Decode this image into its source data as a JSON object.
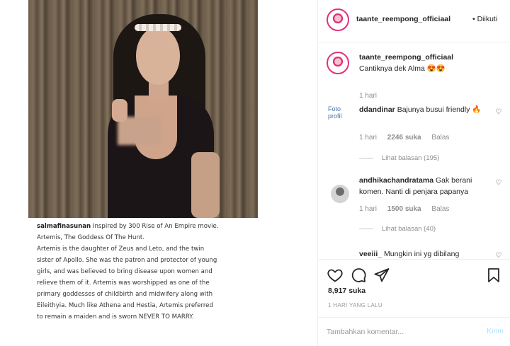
{
  "post": {
    "caption": {
      "username": "salmafinasunan",
      "first_line": "Inspired by 300 Rise of An Empire movie.",
      "lines": [
        "Artemis, The Goddess Of The Hunt.",
        "Artemis is the daughter of Zeus and Leto, and the twin sister of Apollo. She was the patron and protector of young girls, and was believed to bring disease upon women and relieve them of it. Artemis was worshipped as one of the primary goddesses of childbirth and midwifery along with Eileithyia. Much like Athena and Hestia, Artemis preferred to remain a maiden and is sworn NEVER TO MARRY."
      ]
    }
  },
  "header": {
    "username": "taante_reempong_officiaal",
    "follow_status": "• Diikuti"
  },
  "comments": [
    {
      "username": "taante_reempong_officiaal",
      "text": "Cantiknya dek Alma 😍😍",
      "time": "1 hari",
      "likes": "",
      "reply": "",
      "replies": ""
    },
    {
      "username": "ddandinar",
      "text": "Bajunya busui friendly 🔥",
      "time": "1 hari",
      "likes": "2246 suka",
      "reply": "Balas",
      "replies": "Lihat balasan (195)",
      "avatar_alt": "Foto profil"
    },
    {
      "username": "andhikachandratama",
      "text": "Gak berani komen. Nanti di penjara papanya",
      "time": "1 hari",
      "likes": "1500 suka",
      "reply": "Balas",
      "replies": "Lihat balasan (40)"
    },
    {
      "username": "veeiii_",
      "text": "Mungkin ini yg dibilang"
    }
  ],
  "actions": {
    "likes": "8,917 suka",
    "time": "1 HARI YANG LALU"
  },
  "add_comment": {
    "placeholder": "Tambahkan komentar...",
    "post_label": "Kirim"
  },
  "icons": [
    "heart-icon",
    "comment-icon",
    "share-icon",
    "bookmark-icon"
  ],
  "colors": {
    "accent": "#e0327a",
    "post_disabled": "#b2dffc"
  }
}
